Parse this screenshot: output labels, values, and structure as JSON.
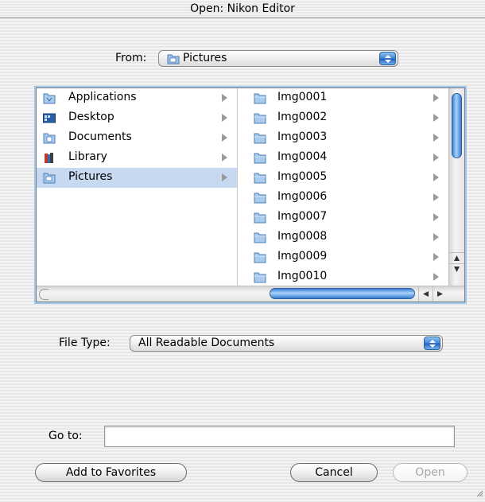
{
  "window": {
    "title": "Open: Nikon Editor"
  },
  "from": {
    "label": "From:",
    "selected": "Pictures",
    "icon": "pictures-folder-icon"
  },
  "sidebar": {
    "items": [
      {
        "label": "Applications",
        "icon": "applications-folder-icon"
      },
      {
        "label": "Desktop",
        "icon": "desktop-icon"
      },
      {
        "label": "Documents",
        "icon": "documents-folder-icon"
      },
      {
        "label": "Library",
        "icon": "library-folder-icon"
      },
      {
        "label": "Pictures",
        "icon": "pictures-folder-icon",
        "selected": true
      }
    ]
  },
  "files": {
    "items": [
      {
        "label": "Img0001"
      },
      {
        "label": "Img0002"
      },
      {
        "label": "Img0003"
      },
      {
        "label": "Img0004"
      },
      {
        "label": "Img0005"
      },
      {
        "label": "Img0006"
      },
      {
        "label": "Img0007"
      },
      {
        "label": "Img0008"
      },
      {
        "label": "Img0009"
      },
      {
        "label": "Img0010"
      }
    ]
  },
  "file_type": {
    "label": "File Type:",
    "selected": "All Readable Documents"
  },
  "goto": {
    "label": "Go to:",
    "value": ""
  },
  "buttons": {
    "favorites": "Add to Favorites",
    "cancel": "Cancel",
    "open": "Open"
  },
  "colors": {
    "selection": "#c7d9f0",
    "accent": "#3d84d6"
  }
}
